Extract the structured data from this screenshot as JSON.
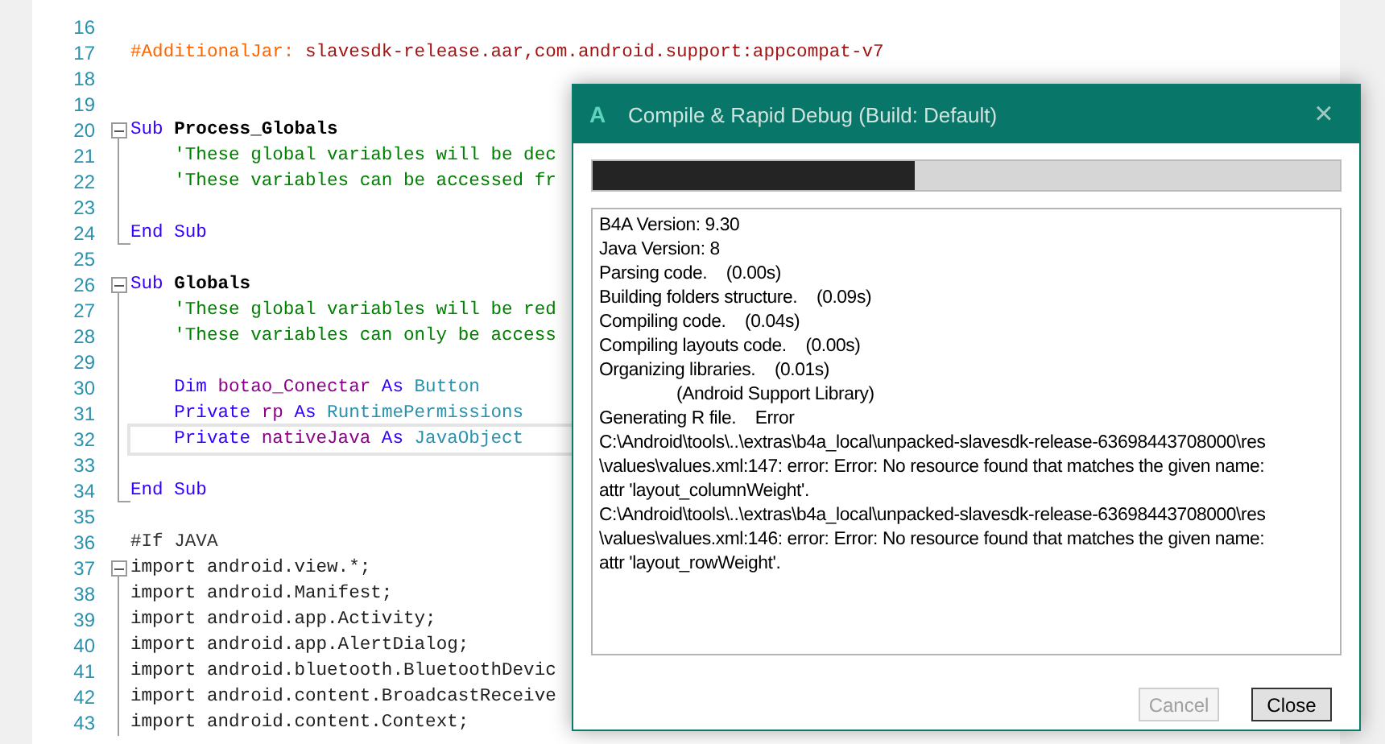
{
  "editor": {
    "lines": [
      {
        "number": "16",
        "kind": "plain"
      },
      {
        "number": "17",
        "kind": "plain",
        "tokens": [
          {
            "kind": "directive",
            "text": "#AdditionalJar:"
          },
          {
            "kind": "string",
            "text": " slavesdk-release.aar,com.android.support:appcompat-v7"
          }
        ]
      },
      {
        "number": "18",
        "kind": "plain"
      },
      {
        "number": "19",
        "kind": "plain"
      },
      {
        "number": "20",
        "kind": "fold-start",
        "tokens": [
          {
            "kind": "keyword",
            "text": "Sub"
          },
          {
            "kind": "name",
            "text": " Process_Globals"
          }
        ]
      },
      {
        "number": "21",
        "kind": "fold-body",
        "indent": true,
        "tokens": [
          {
            "kind": "comment",
            "text": "'These global variables will be dec"
          }
        ]
      },
      {
        "number": "22",
        "kind": "fold-body",
        "indent": true,
        "tokens": [
          {
            "kind": "comment",
            "text": "'These variables can be accessed fr"
          }
        ]
      },
      {
        "number": "23",
        "kind": "fold-body"
      },
      {
        "number": "24",
        "kind": "fold-end",
        "tokens": [
          {
            "kind": "keyword",
            "text": "End Sub"
          }
        ]
      },
      {
        "number": "25",
        "kind": "plain"
      },
      {
        "number": "26",
        "kind": "fold-start",
        "tokens": [
          {
            "kind": "keyword",
            "text": "Sub"
          },
          {
            "kind": "name",
            "text": " Globals"
          }
        ]
      },
      {
        "number": "27",
        "kind": "fold-body",
        "indent": true,
        "tokens": [
          {
            "kind": "comment",
            "text": "'These global variables will be red"
          }
        ]
      },
      {
        "number": "28",
        "kind": "fold-body",
        "indent": true,
        "tokens": [
          {
            "kind": "comment",
            "text": "'These variables can only be access"
          }
        ]
      },
      {
        "number": "29",
        "kind": "fold-body"
      },
      {
        "number": "30",
        "kind": "fold-body",
        "indent": true,
        "tokens": [
          {
            "kind": "keyword",
            "text": "Dim"
          },
          {
            "kind": "variable",
            "text": " botao_Conectar"
          },
          {
            "kind": "keyword",
            "text": " As"
          },
          {
            "kind": "type",
            "text": " Button"
          }
        ]
      },
      {
        "number": "31",
        "kind": "fold-body",
        "indent": true,
        "tokens": [
          {
            "kind": "keyword",
            "text": "Private"
          },
          {
            "kind": "variable",
            "text": " rp"
          },
          {
            "kind": "keyword",
            "text": " As"
          },
          {
            "kind": "type",
            "text": " RuntimePermissions"
          }
        ]
      },
      {
        "number": "32",
        "kind": "fold-body",
        "indent": true,
        "current": true,
        "tokens": [
          {
            "kind": "keyword",
            "text": "Private"
          },
          {
            "kind": "variable",
            "text": " nativeJava"
          },
          {
            "kind": "keyword",
            "text": " As"
          },
          {
            "kind": "type",
            "text": " JavaObject"
          }
        ]
      },
      {
        "number": "33",
        "kind": "fold-body"
      },
      {
        "number": "34",
        "kind": "fold-end",
        "tokens": [
          {
            "kind": "keyword",
            "text": "End Sub"
          }
        ]
      },
      {
        "number": "35",
        "kind": "plain"
      },
      {
        "number": "36",
        "kind": "plain",
        "tokens": [
          {
            "kind": "preproc",
            "text": "#If JAVA"
          }
        ]
      },
      {
        "number": "37",
        "kind": "fold-start",
        "tokens": [
          {
            "kind": "plain",
            "text": "import android.view.*;"
          }
        ]
      },
      {
        "number": "38",
        "kind": "fold-body",
        "tokens": [
          {
            "kind": "plain",
            "text": "import android.Manifest;"
          }
        ]
      },
      {
        "number": "39",
        "kind": "fold-body",
        "tokens": [
          {
            "kind": "plain",
            "text": "import android.app.Activity;"
          }
        ]
      },
      {
        "number": "40",
        "kind": "fold-body",
        "tokens": [
          {
            "kind": "plain",
            "text": "import android.app.AlertDialog;"
          }
        ]
      },
      {
        "number": "41",
        "kind": "fold-body",
        "tokens": [
          {
            "kind": "plain",
            "text": "import android.bluetooth.BluetoothDevic"
          }
        ]
      },
      {
        "number": "42",
        "kind": "fold-body",
        "tokens": [
          {
            "kind": "plain",
            "text": "import android.content.BroadcastReceive"
          }
        ]
      },
      {
        "number": "43",
        "kind": "fold-body",
        "tokens": [
          {
            "kind": "plain",
            "text": "import android.content.Context;"
          }
        ]
      }
    ]
  },
  "dialog": {
    "icon": "A",
    "title": "Compile & Rapid Debug (Build: Default)",
    "close": "×",
    "progress": {
      "level": 0.43
    },
    "log": [
      {
        "text": "B4A Version: 9.30"
      },
      {
        "text": "Java Version: 8"
      },
      {
        "text": "Parsing code.    (0.00s)"
      },
      {
        "text": "Building folders structure.    (0.09s)"
      },
      {
        "text": "Compiling code.    (0.04s)"
      },
      {
        "text": "Compiling layouts code.    (0.00s)"
      },
      {
        "text": "Organizing libraries.    (0.01s)"
      },
      {
        "text": "(Android Support Library)",
        "indent": true
      },
      {
        "text": "Generating R file.    Error"
      },
      {
        "text": "C:\\Android\\tools\\..\\extras\\b4a_local\\unpacked-slavesdk-release-63698443708000\\res"
      },
      {
        "text": "\\values\\values.xml:147: error: Error: No resource found that matches the given name:"
      },
      {
        "text": "attr 'layout_columnWeight'."
      },
      {
        "text": "C:\\Android\\tools\\..\\extras\\b4a_local\\unpacked-slavesdk-release-63698443708000\\res"
      },
      {
        "text": "\\values\\values.xml:146: error: Error: No resource found that matches the given name:"
      },
      {
        "text": "attr 'layout_rowWeight'."
      }
    ],
    "buttons": [
      {
        "label": "Cancel",
        "disabled": true
      },
      {
        "label": "Close",
        "disabled": false
      }
    ]
  }
}
